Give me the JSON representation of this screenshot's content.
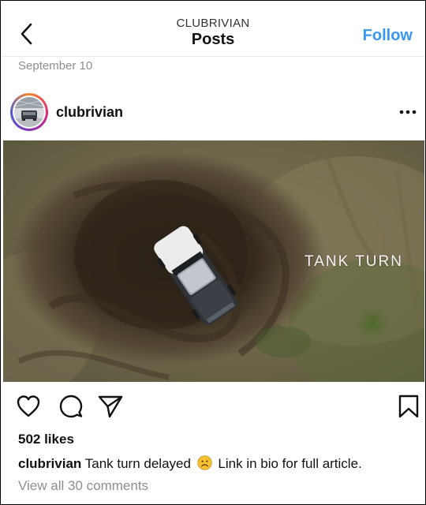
{
  "header": {
    "account": "CLUBRIVIAN",
    "title": "Posts",
    "follow_label": "Follow"
  },
  "post": {
    "date": "September 10",
    "username": "clubrivian",
    "overlay_text": "TANK TURN",
    "likes": "502 likes",
    "caption_user": "clubrivian",
    "caption_text_before": "Tank turn delayed",
    "caption_text_after": "Link in bio for full article.",
    "view_comments": "View all 30 comments"
  },
  "icons": {
    "back": "chevron-left-icon",
    "more": "more-options-icon",
    "like": "heart-icon",
    "comment": "comment-icon",
    "share": "send-icon",
    "save": "bookmark-icon",
    "caption_emoji": "frowning-face-icon"
  },
  "colors": {
    "follow": "#3897f0",
    "muted_text": "#8e8e8e"
  }
}
